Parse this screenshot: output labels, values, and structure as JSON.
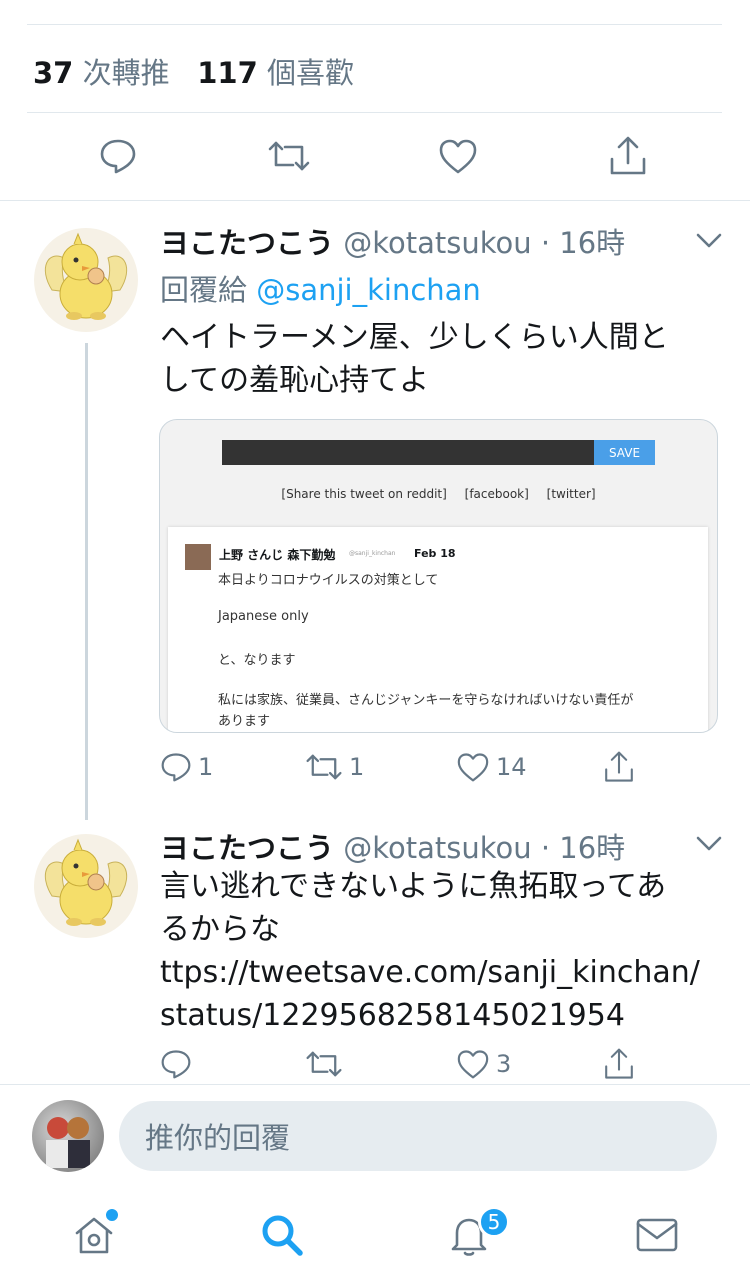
{
  "stats": {
    "retweets_count": "37",
    "retweets_label": "次轉推",
    "likes_count": "117",
    "likes_label": "個喜歡"
  },
  "tweet1": {
    "name": "ヨこたつこう",
    "handle_time": "@kotatsukou · 16時",
    "reply_prefix": "回覆給",
    "reply_to": "@sanji_kinchan",
    "text_line1": "ヘイトラーメン屋、少しくらい人間と",
    "text_line2": "しての羞恥心持てよ",
    "card": {
      "save_label": "SAVE",
      "link_reddit": "[Share this tweet on reddit]",
      "link_facebook": "[facebook]",
      "link_twitter": "[twitter]",
      "inner_name": "上野 さんじ 森下勤勉",
      "inner_handle": "@sanji_kinchan",
      "inner_date": "Feb 18",
      "inner_line1": "本日よりコロナウイルスの対策として",
      "inner_line2": "Japanese only",
      "inner_line3": "と、なります",
      "inner_line4": "私には家族、従業員、さんじジャンキーを守らなければいけない責任が",
      "inner_line5": "あります"
    },
    "replies": "1",
    "retweets": "1",
    "likes": "14"
  },
  "tweet2": {
    "name": "ヨこたつこう",
    "handle_time": "@kotatsukou · 16時",
    "text_line1": "言い逃れできないように魚拓取ってあ",
    "text_line2": "るからな",
    "link_line1": "ttps://tweetsave.com/sanji_kinchan/",
    "link_line2": "status/1229568258145021954",
    "likes": "3"
  },
  "reply_input": {
    "placeholder": "推你的回覆"
  },
  "tabbar": {
    "notifications_badge": "5"
  },
  "colors": {
    "accent": "#1da1f2",
    "text": "#14171a",
    "muted": "#657786"
  }
}
